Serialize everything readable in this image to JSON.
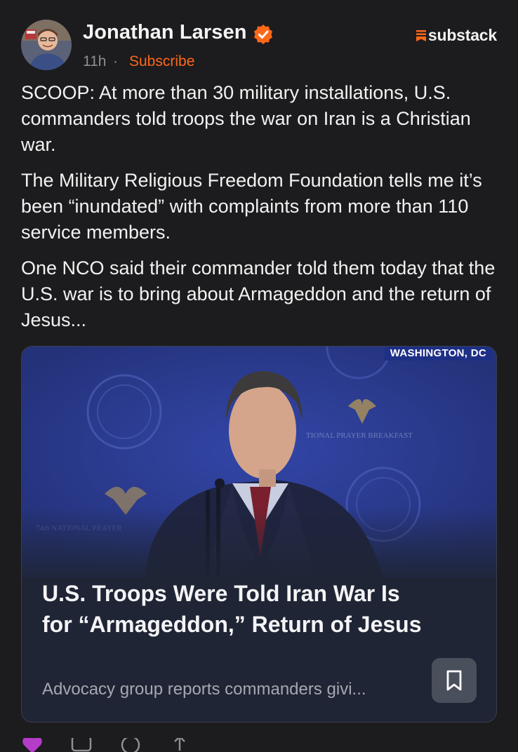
{
  "author": {
    "name": "Jonathan Larsen",
    "time": "11h",
    "separator": "·",
    "subscribe_label": "Subscribe"
  },
  "brand": {
    "name": "substack",
    "icon": "substack-logo-icon",
    "color": "#ff6719"
  },
  "post": {
    "paragraphs": [
      "SCOOP: At more than 30 military installations, U.S. commanders told troops the war on Iran is a Christian war.",
      "The Military Religious Freedom Foundation tells me it’s been “inundated” with complaints from more than 110 service members.",
      "One NCO said their commander told them today that the U.S. war is to bring about Armageddon and the return of Jesus..."
    ]
  },
  "card": {
    "image_caption": "WASHINGTON, DC",
    "title": "U.S. Troops Were Told Iran War Is for “Armageddon,” Return of Jesus",
    "subtitle": "Advocacy group reports commanders givi...",
    "bookmark_icon": "bookmark-icon"
  },
  "actions": [
    {
      "icon": "heart-icon",
      "count": ""
    },
    {
      "icon": "comment-icon",
      "count": ""
    },
    {
      "icon": "restack-icon",
      "count": ""
    },
    {
      "icon": "share-icon",
      "count": ""
    }
  ],
  "colors": {
    "background": "#1c1c1e",
    "accent": "#ff6719",
    "card_background": "#1f2535",
    "verified": "#ff6719"
  }
}
